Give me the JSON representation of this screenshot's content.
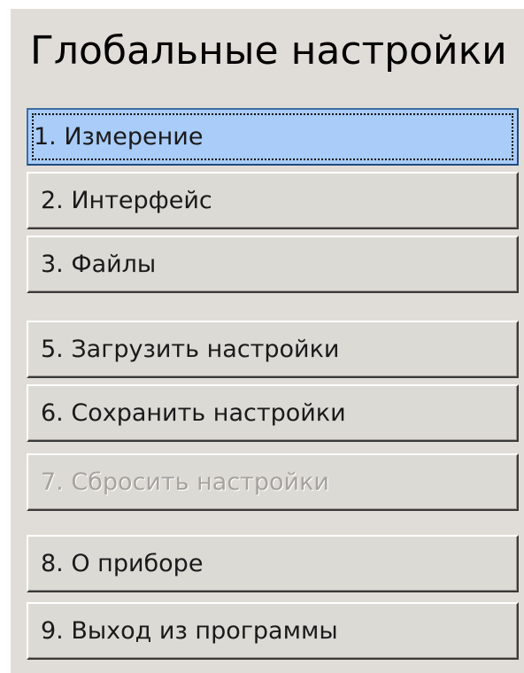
{
  "window": {
    "title": "Глобальные настройки"
  },
  "menu": {
    "items": [
      {
        "label": "1. Измерение",
        "state": "selected"
      },
      {
        "label": "2. Интерфейс",
        "state": "normal"
      },
      {
        "label": "3. Файлы",
        "state": "normal"
      },
      {
        "label": "5. Загрузить настройки",
        "state": "normal"
      },
      {
        "label": "6. Сохранить настройки",
        "state": "normal"
      },
      {
        "label": "7. Сбросить настройки",
        "state": "disabled"
      },
      {
        "label": "8. О приборе",
        "state": "normal"
      },
      {
        "label": "9. Выход из программы",
        "state": "normal"
      }
    ]
  },
  "colors": {
    "panel_bg": "#e0ddd8",
    "button_bg": "#dcdad5",
    "selected_bg": "#a9ccf9",
    "disabled_text": "#a6a39e"
  }
}
